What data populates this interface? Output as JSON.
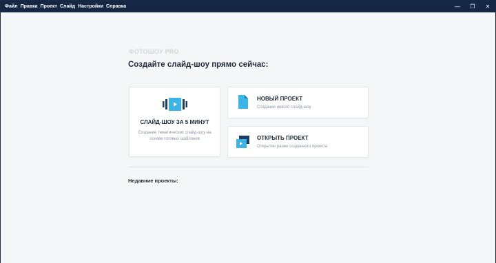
{
  "menu": [
    "Файл",
    "Правка",
    "Проект",
    "Слайд",
    "Настройки",
    "Справка"
  ],
  "window_controls": {
    "minimize": "—",
    "maximize": "❐",
    "close": "✕"
  },
  "app": {
    "logo": "ФОТОШОУ PRO",
    "heading": "Создайте слайд-шоу прямо сейчас:"
  },
  "cards": {
    "quick": {
      "icon": "filmstrip-play-icon",
      "title": "СЛАЙД-ШОУ ЗА 5 МИНУТ",
      "subtitle": "Создание тематических слайд-шоу на основе готовых шаблонов"
    },
    "new_project": {
      "icon": "document-icon",
      "title": "НОВЫЙ ПРОЕКТ",
      "subtitle": "Создание нового слайд-шоу"
    },
    "open_project": {
      "icon": "open-folder-icon",
      "title": "ОТКРЫТЬ ПРОЕКТ",
      "subtitle": "Открытие ранее созданного проекта"
    }
  },
  "recent": {
    "label": "Недавние проекты:"
  },
  "colors": {
    "titlebar": "#152744",
    "accent": "#3cb4e6",
    "dark_icon": "#1d3f63",
    "text": "#1f2a37",
    "muted": "#8b93a1"
  }
}
